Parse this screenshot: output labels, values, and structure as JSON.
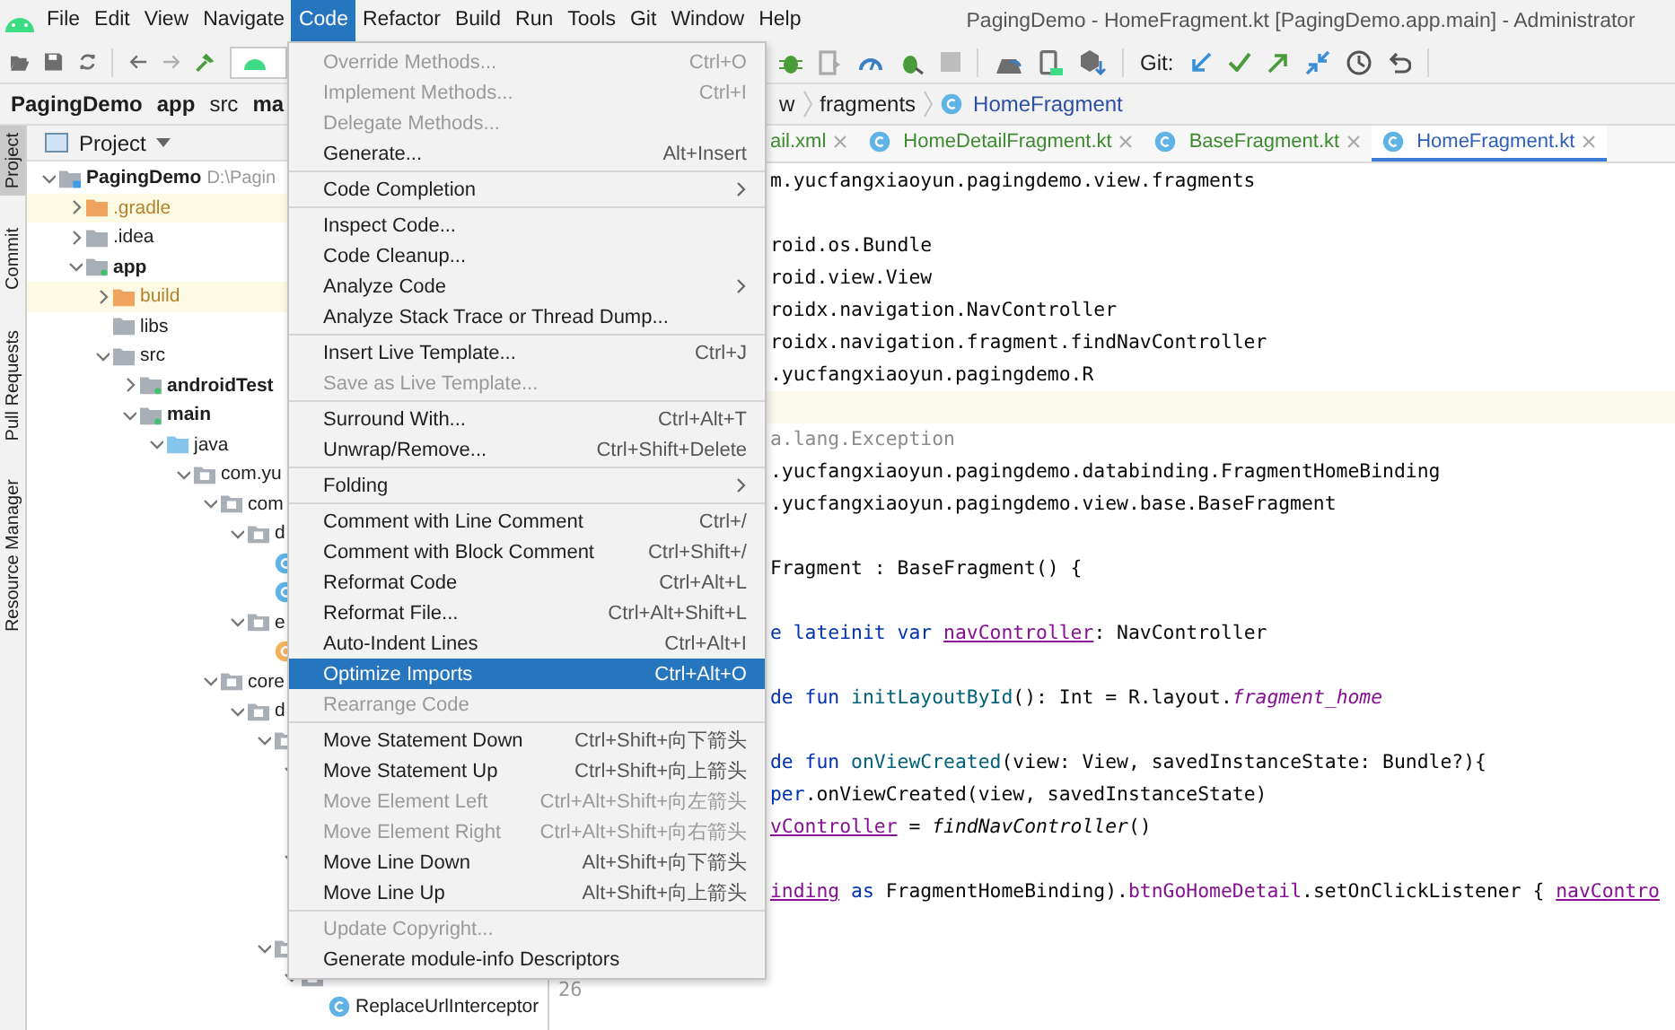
{
  "menu_bar": {
    "items": [
      {
        "label": "File",
        "selected": false
      },
      {
        "label": "Edit",
        "selected": false
      },
      {
        "label": "View",
        "selected": false
      },
      {
        "label": "Navigate",
        "selected": false
      },
      {
        "label": "Code",
        "selected": true
      },
      {
        "label": "Refactor",
        "selected": false
      },
      {
        "label": "Build",
        "selected": false
      },
      {
        "label": "Run",
        "selected": false
      },
      {
        "label": "Tools",
        "selected": false
      },
      {
        "label": "Git",
        "selected": false
      },
      {
        "label": "Window",
        "selected": false
      },
      {
        "label": "Help",
        "selected": false
      }
    ],
    "title": "PagingDemo - HomeFragment.kt [PagingDemo.app.main] - Administrator"
  },
  "toolbar": {
    "git_label": "Git:"
  },
  "breadcrumbs": {
    "leading": [
      {
        "label": "PagingDemo",
        "kind": "module"
      },
      {
        "label": "app",
        "kind": "module"
      },
      {
        "label": "src",
        "kind": "folder"
      },
      {
        "label": "ma",
        "kind": "module"
      }
    ],
    "trailing": [
      {
        "label": "w",
        "kind": "folder"
      },
      {
        "label": "fragments",
        "kind": "folder"
      },
      {
        "label": "HomeFragment",
        "kind": "class"
      }
    ]
  },
  "tool_strip": [
    {
      "label": "Project",
      "selected": true
    },
    {
      "label": "Commit",
      "selected": false
    },
    {
      "label": "Pull Requests",
      "selected": false
    },
    {
      "label": "Resource Manager",
      "selected": false
    }
  ],
  "project_panel": {
    "title": "Project",
    "tree": [
      {
        "label": "PagingDemo",
        "path": "D:\\Pagin",
        "kind": "project",
        "expanded": true,
        "children": [
          {
            "label": ".gradle",
            "kind": "folder",
            "expanded": false,
            "excluded": true
          },
          {
            "label": ".idea",
            "kind": "folder",
            "expanded": false
          },
          {
            "label": "app",
            "kind": "module",
            "expanded": true,
            "children": [
              {
                "label": "build",
                "kind": "folder",
                "expanded": false,
                "excluded": true
              },
              {
                "label": "libs",
                "kind": "folder"
              },
              {
                "label": "src",
                "kind": "folder",
                "expanded": true,
                "children": [
                  {
                    "label": "androidTest",
                    "kind": "module",
                    "expanded": false
                  },
                  {
                    "label": "main",
                    "kind": "module",
                    "expanded": true,
                    "children": [
                      {
                        "label": "java",
                        "kind": "source",
                        "expanded": true,
                        "children": [
                          {
                            "label": "com.yu",
                            "kind": "package",
                            "expanded": true,
                            "children": [
                              {
                                "label": "com",
                                "kind": "package",
                                "expanded": true,
                                "children": [
                                  {
                                    "label": "d",
                                    "kind": "package",
                                    "expanded": true,
                                    "children": [
                                      {
                                        "kind": "class"
                                      },
                                      {
                                        "kind": "class"
                                      }
                                    ]
                                  },
                                  {
                                    "label": "e",
                                    "kind": "package",
                                    "expanded": true,
                                    "children": [
                                      {
                                        "kind": "object"
                                      }
                                    ]
                                  }
                                ]
                              },
                              {
                                "label": "core",
                                "kind": "package",
                                "expanded": true,
                                "children": [
                                  {
                                    "label": "d",
                                    "kind": "package",
                                    "expanded": true,
                                    "children": [
                                      {
                                        "kind": "package",
                                        "expanded": true,
                                        "children": [
                                          {
                                            "expanded": true,
                                            "children": [
                                              {
                                                "kind": "file"
                                              },
                                              {
                                                "kind": "file"
                                              }
                                            ]
                                          },
                                          {
                                            "expanded": true,
                                            "children": [
                                              {
                                                "kind": "file"
                                              },
                                              {
                                                "kind": "file"
                                              }
                                            ]
                                          }
                                        ]
                                      },
                                      {
                                        "kind": "package",
                                        "expanded": true,
                                        "children": [
                                          {
                                            "kind": "package",
                                            "expanded": true,
                                            "children": [
                                              {
                                                "label": "ReplaceUrlInterceptor",
                                                "kind": "class"
                                              }
                                            ]
                                          }
                                        ]
                                      }
                                    ]
                                  }
                                ]
                              }
                            ]
                          }
                        ]
                      }
                    ]
                  }
                ]
              }
            ]
          }
        ]
      }
    ]
  },
  "editor": {
    "tabs": [
      {
        "label": "ail.xml",
        "selected": false,
        "modified": false
      },
      {
        "label": "HomeDetailFragment.kt",
        "selected": false,
        "modified": false
      },
      {
        "label": "BaseFragment.kt",
        "selected": false,
        "modified": false
      },
      {
        "label": "HomeFragment.kt",
        "selected": true,
        "modified": true
      }
    ],
    "lines": [
      {
        "kind": "code",
        "tokens": [
          {
            "text": "m.yucfangxiaoyun.pagingdemo.view.fragments",
            "kind": "plain"
          }
        ]
      },
      {
        "kind": "blank"
      },
      {
        "kind": "code",
        "tokens": [
          {
            "text": "roid.os.Bundle",
            "kind": "plain"
          }
        ]
      },
      {
        "kind": "code",
        "tokens": [
          {
            "text": "roid.view.View",
            "kind": "plain"
          }
        ]
      },
      {
        "kind": "code",
        "tokens": [
          {
            "text": "roidx.navigation.NavController",
            "kind": "plain"
          }
        ]
      },
      {
        "kind": "code",
        "tokens": [
          {
            "text": "roidx.navigation.fragment.findNavController",
            "kind": "plain"
          }
        ]
      },
      {
        "kind": "code",
        "tokens": [
          {
            "text": ".yucfangxiaoyun.pagingdemo.R",
            "kind": "plain"
          }
        ]
      },
      {
        "kind": "blank",
        "current": true
      },
      {
        "kind": "code",
        "tokens": [
          {
            "text": "a.lang.Exception",
            "kind": "unused"
          }
        ]
      },
      {
        "kind": "code",
        "tokens": [
          {
            "text": ".yucfangxiaoyun.pagingdemo.databinding.FragmentHomeBinding",
            "kind": "plain"
          }
        ]
      },
      {
        "kind": "code",
        "tokens": [
          {
            "text": ".yucfangxiaoyun.pagingdemo.view.base.BaseFragment",
            "kind": "plain"
          }
        ]
      },
      {
        "kind": "blank"
      },
      {
        "kind": "code",
        "tokens": [
          {
            "text": "Fragment : BaseFragment() {",
            "kind": "plain"
          }
        ]
      },
      {
        "kind": "blank"
      },
      {
        "kind": "code",
        "tokens": [
          {
            "text": "e lateinit var ",
            "kind": "keyword"
          },
          {
            "text": "navController",
            "kind": "property"
          },
          {
            "text": ": NavController",
            "kind": "plain"
          }
        ]
      },
      {
        "kind": "blank"
      },
      {
        "kind": "code",
        "tokens": [
          {
            "text": "de fun ",
            "kind": "keyword"
          },
          {
            "text": "initLayoutById",
            "kind": "function"
          },
          {
            "text": "(): Int = R.layout.",
            "kind": "plain"
          },
          {
            "text": "fragment_home",
            "kind": "constant"
          }
        ]
      },
      {
        "kind": "blank"
      },
      {
        "kind": "code",
        "tokens": [
          {
            "text": "de fun ",
            "kind": "keyword"
          },
          {
            "text": "onViewCreated",
            "kind": "function"
          },
          {
            "text": "(view: View, savedInstanceState: Bundle?){",
            "kind": "plain"
          }
        ]
      },
      {
        "kind": "code",
        "tokens": [
          {
            "text": "per",
            "kind": "keyword"
          },
          {
            "text": ".onViewCreated(view, savedInstanceState)",
            "kind": "plain"
          }
        ]
      },
      {
        "kind": "code",
        "tokens": [
          {
            "text": "vController",
            "kind": "property"
          },
          {
            "text": " = ",
            "kind": "plain"
          },
          {
            "text": "findNavController",
            "kind": "call"
          },
          {
            "text": "()",
            "kind": "plain"
          }
        ]
      },
      {
        "kind": "blank"
      },
      {
        "kind": "code",
        "tokens": [
          {
            "text": "inding",
            "kind": "property"
          },
          {
            "text": " as ",
            "kind": "keyword"
          },
          {
            "text": "FragmentHomeBinding).",
            "kind": "plain"
          },
          {
            "text": "btnGoHomeDetail",
            "kind": "field"
          },
          {
            "text": ".setOnClickListener { ",
            "kind": "plain"
          },
          {
            "text": "navContro",
            "kind": "property"
          }
        ]
      },
      {
        "kind": "blank"
      },
      {
        "kind": "blank"
      },
      {
        "kind": "blank",
        "number": "26"
      }
    ]
  },
  "code_menu": {
    "groups": [
      [
        {
          "label": "Override Methods...",
          "shortcut": "Ctrl+O",
          "kind": "action",
          "disabled": true,
          "selected": false
        },
        {
          "label": "Implement Methods...",
          "shortcut": "Ctrl+I",
          "kind": "action",
          "disabled": true,
          "selected": false
        },
        {
          "label": "Delegate Methods...",
          "kind": "action",
          "disabled": true,
          "selected": false
        },
        {
          "label": "Generate...",
          "shortcut": "Alt+Insert",
          "kind": "action",
          "disabled": false,
          "selected": false
        }
      ],
      [
        {
          "label": "Code Completion",
          "kind": "submenu",
          "disabled": false,
          "selected": false
        }
      ],
      [
        {
          "label": "Inspect Code...",
          "kind": "action",
          "disabled": false,
          "selected": false
        },
        {
          "label": "Code Cleanup...",
          "kind": "action",
          "disabled": false,
          "selected": false
        },
        {
          "label": "Analyze Code",
          "kind": "submenu",
          "disabled": false,
          "selected": false
        },
        {
          "label": "Analyze Stack Trace or Thread Dump...",
          "kind": "action",
          "disabled": false,
          "selected": false
        }
      ],
      [
        {
          "label": "Insert Live Template...",
          "shortcut": "Ctrl+J",
          "kind": "action",
          "disabled": false,
          "selected": false
        },
        {
          "label": "Save as Live Template...",
          "kind": "action",
          "disabled": true,
          "selected": false
        }
      ],
      [
        {
          "label": "Surround With...",
          "shortcut": "Ctrl+Alt+T",
          "kind": "action",
          "disabled": false,
          "selected": false
        },
        {
          "label": "Unwrap/Remove...",
          "shortcut": "Ctrl+Shift+Delete",
          "kind": "action",
          "disabled": false,
          "selected": false
        }
      ],
      [
        {
          "label": "Folding",
          "kind": "submenu",
          "disabled": false,
          "selected": false
        }
      ],
      [
        {
          "label": "Comment with Line Comment",
          "shortcut": "Ctrl+/",
          "kind": "action",
          "disabled": false,
          "selected": false
        },
        {
          "label": "Comment with Block Comment",
          "shortcut": "Ctrl+Shift+/",
          "kind": "action",
          "disabled": false,
          "selected": false
        },
        {
          "label": "Reformat Code",
          "shortcut": "Ctrl+Alt+L",
          "kind": "action",
          "disabled": false,
          "selected": false
        },
        {
          "label": "Reformat File...",
          "shortcut": "Ctrl+Alt+Shift+L",
          "kind": "action",
          "disabled": false,
          "selected": false
        },
        {
          "label": "Auto-Indent Lines",
          "shortcut": "Ctrl+Alt+I",
          "kind": "action",
          "disabled": false,
          "selected": false
        },
        {
          "label": "Optimize Imports",
          "shortcut": "Ctrl+Alt+O",
          "kind": "action",
          "disabled": false,
          "selected": true
        },
        {
          "label": "Rearrange Code",
          "kind": "action",
          "disabled": true,
          "selected": false
        }
      ],
      [
        {
          "label": "Move Statement Down",
          "shortcut": "Ctrl+Shift+向下箭头",
          "kind": "action",
          "disabled": false,
          "selected": false
        },
        {
          "label": "Move Statement Up",
          "shortcut": "Ctrl+Shift+向上箭头",
          "kind": "action",
          "disabled": false,
          "selected": false
        },
        {
          "label": "Move Element Left",
          "shortcut": "Ctrl+Alt+Shift+向左箭头",
          "kind": "action",
          "disabled": true,
          "selected": false
        },
        {
          "label": "Move Element Right",
          "shortcut": "Ctrl+Alt+Shift+向右箭头",
          "kind": "action",
          "disabled": true,
          "selected": false
        },
        {
          "label": "Move Line Down",
          "shortcut": "Alt+Shift+向下箭头",
          "kind": "action",
          "disabled": false,
          "selected": false
        },
        {
          "label": "Move Line Up",
          "shortcut": "Alt+Shift+向上箭头",
          "kind": "action",
          "disabled": false,
          "selected": false
        }
      ],
      [
        {
          "label": "Update Copyright...",
          "kind": "action",
          "disabled": true,
          "selected": false
        },
        {
          "label": "Generate module-info Descriptors",
          "kind": "action",
          "disabled": false,
          "selected": false
        }
      ]
    ]
  }
}
